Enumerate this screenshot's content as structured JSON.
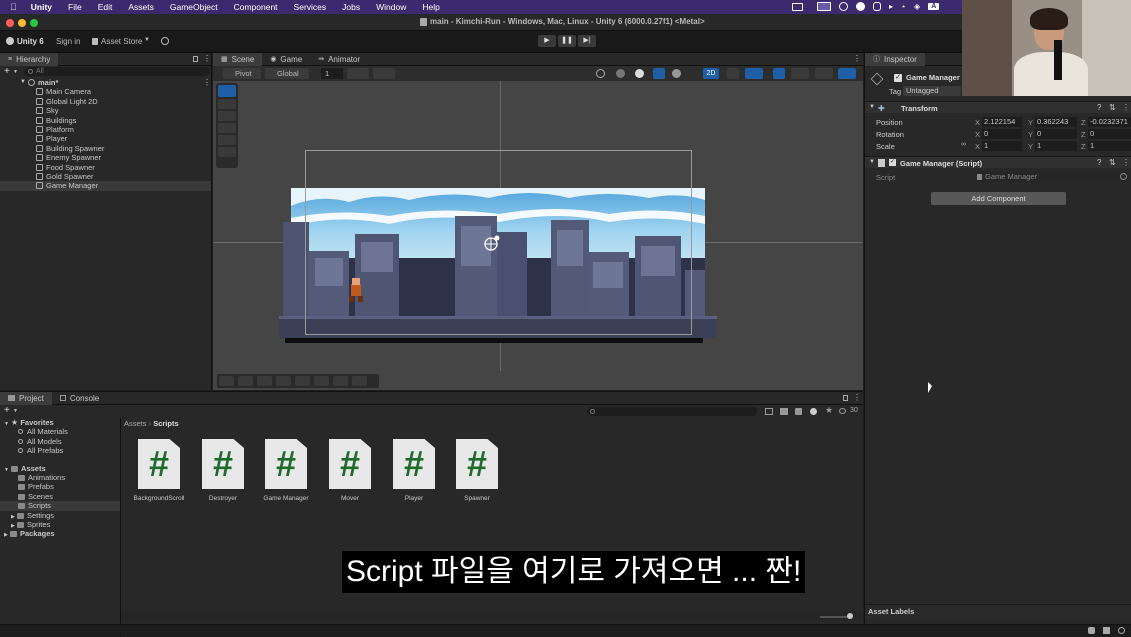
{
  "menubar": {
    "app": "Unity",
    "items": [
      "File",
      "Edit",
      "Assets",
      "GameObject",
      "Component",
      "Services",
      "Jobs",
      "Window",
      "Help"
    ],
    "right_letter": "A"
  },
  "titlebar": {
    "title": "main - Kimchi-Run - Windows, Mac, Linux - Unity 6 (6000.0.27f1) <Metal>"
  },
  "toolbar": {
    "account": "Unity 6",
    "sign_in": "Sign in",
    "asset_store": "Asset Store"
  },
  "hierarchy": {
    "tab": "Hierarchy",
    "search_placeholder": "All",
    "scene": "main*",
    "items": [
      "Main Camera",
      "Global Light 2D",
      "Sky",
      "Buildings",
      "Platform",
      "Player",
      "Building Spawner",
      "Enemy Spawner",
      "Food Spawner",
      "Gold Spawner",
      "Game Manager"
    ]
  },
  "scene": {
    "tabs": [
      "Scene",
      "Game",
      "Animator"
    ],
    "pivot": "Pivot",
    "global": "Global",
    "grid_value": "1",
    "toggle_2d": "2D"
  },
  "inspector": {
    "tab": "Inspector",
    "object_name": "Game Manager",
    "tag_label": "Tag",
    "tag_value": "Untagged",
    "transform": {
      "title": "Transform",
      "position_label": "Position",
      "rotation_label": "Rotation",
      "scale_label": "Scale",
      "position": {
        "x": "2.122154",
        "y": "0.362243",
        "z": "-0.0232371"
      },
      "rotation": {
        "x": "0",
        "y": "0",
        "z": "0"
      },
      "scale": {
        "x": "1",
        "y": "1",
        "z": "1"
      }
    },
    "script_component": {
      "title": "Game Manager (Script)",
      "script_label": "Script",
      "script_value": "Game Manager"
    },
    "add_component": "Add Component",
    "asset_labels": "Asset Labels"
  },
  "project": {
    "tabs": [
      "Project",
      "Console"
    ],
    "favorites": {
      "label": "Favorites",
      "items": [
        "All Materials",
        "All Models",
        "All Prefabs"
      ]
    },
    "assets": {
      "label": "Assets",
      "items": [
        "Animations",
        "Prefabs",
        "Scenes",
        "Scripts",
        "Settings",
        "Sprites"
      ]
    },
    "packages": "Packages",
    "breadcrumb": [
      "Assets",
      "Scripts"
    ],
    "visible_count": "30",
    "files": [
      "BackgroundScroll",
      "Destroyer",
      "Game Manager",
      "Mover",
      "Player",
      "Spawner"
    ]
  },
  "subtitle": "Script 파일을 여기로 가져오면 ... 짠!",
  "colors": {
    "menubar": "#3c2a6e",
    "editor_bg": "#282828",
    "scene_bg": "#454545",
    "sky": "#8fc8ea",
    "script_hash": "#1e6b2e"
  }
}
